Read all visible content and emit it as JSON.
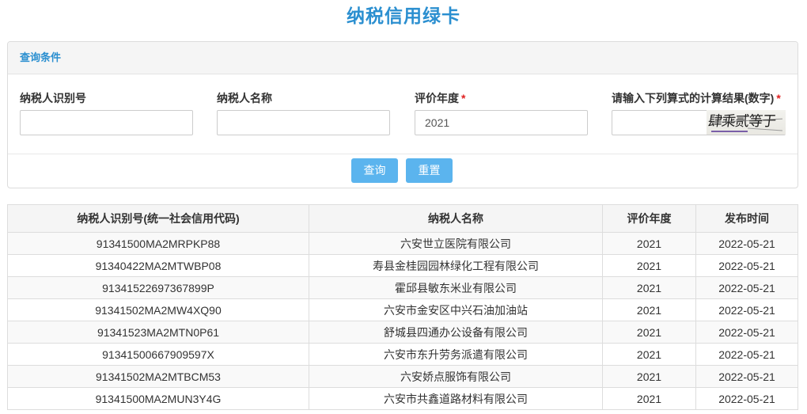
{
  "page": {
    "title": "纳税信用绿卡"
  },
  "query_panel": {
    "heading": "查询条件",
    "required_mark": "*",
    "fields": {
      "taxpayer_id": {
        "label": "纳税人识别号",
        "value": ""
      },
      "taxpayer_name": {
        "label": "纳税人名称",
        "value": ""
      },
      "rating_year": {
        "label": "评价年度",
        "value": "2021",
        "required": true
      },
      "captcha_answer": {
        "label": "请输入下列算式的计算结果(数字)",
        "value": "",
        "required": true,
        "captcha_text": "肆乘贰等于"
      }
    },
    "buttons": {
      "query": "查询",
      "reset": "重置"
    }
  },
  "results_table": {
    "columns": [
      "纳税人识别号(统一社会信用代码)",
      "纳税人名称",
      "评价年度",
      "发布时间"
    ],
    "rows": [
      [
        "91341500MA2MRPKP88",
        "六安世立医院有限公司",
        "2021",
        "2022-05-21"
      ],
      [
        "91340422MA2MTWBP08",
        "寿县金桂园园林绿化工程有限公司",
        "2021",
        "2022-05-21"
      ],
      [
        "91341522697367899P",
        "霍邱县敏东米业有限公司",
        "2021",
        "2022-05-21"
      ],
      [
        "91341502MA2MW4XQ90",
        "六安市金安区中兴石油加油站",
        "2021",
        "2022-05-21"
      ],
      [
        "91341523MA2MTN0P61",
        "舒城县四通办公设备有限公司",
        "2021",
        "2022-05-21"
      ],
      [
        "91341500667909597X",
        "六安市东升劳务派遣有限公司",
        "2021",
        "2022-05-21"
      ],
      [
        "91341502MA2MTBCM53",
        "六安娇点服饰有限公司",
        "2021",
        "2022-05-21"
      ],
      [
        "91341500MA2MUN3Y4G",
        "六安市共鑫道路材料有限公司",
        "2021",
        "2022-05-21"
      ]
    ]
  },
  "colors": {
    "accent": "#2b8fd0",
    "button": "#5bb4ee",
    "required": "#e02020",
    "header_bg": "#f5f5f5",
    "border": "#dddddd"
  }
}
